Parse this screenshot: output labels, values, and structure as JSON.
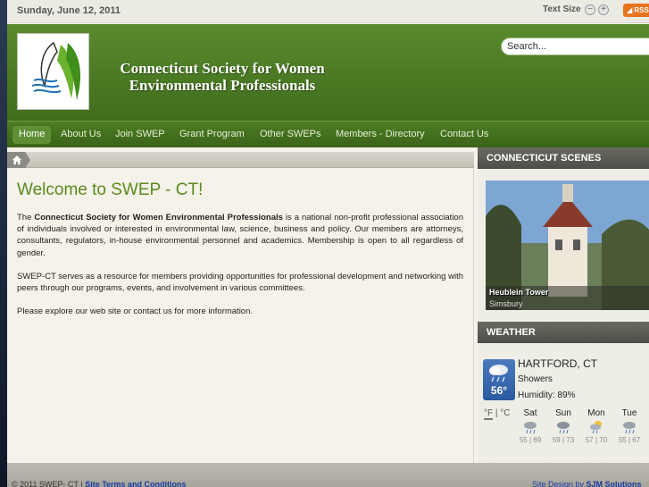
{
  "topbar": {
    "date": "Sunday, June 12, 2011",
    "text_size_label": "Text Size",
    "decrease_glyph": "−",
    "increase_glyph": "+",
    "rss_label": "RSS"
  },
  "header": {
    "title_line1": "Connecticut Society for Women",
    "title_line2": "Environmental Professionals",
    "search_placeholder": "Search..."
  },
  "nav": {
    "items": [
      {
        "label": "Home"
      },
      {
        "label": "About Us"
      },
      {
        "label": "Join SWEP"
      },
      {
        "label": "Grant Program"
      },
      {
        "label": "Other SWEPs"
      },
      {
        "label": "Members - Directory"
      },
      {
        "label": "Contact Us"
      }
    ],
    "active_index": 0
  },
  "content": {
    "heading": "Welcome to SWEP - CT!",
    "para1_prefix": "The",
    "para1_bold": "Connecticut Society for Women Environmental Professionals",
    "para1_rest": "is a national non-profit professional association of individuals involved or interested in environmental law, science, business and policy.  Our members are attorneys, consultants, regulators, in-house environmental personnel and academics.  Membership is open to all regardless of gender.",
    "para2": "SWEP-CT serves as a resource for members providing opportunities for professional development and networking with peers through our programs, events, and involvement in various committees.",
    "para3": "Please explore our web site or contact us for more information."
  },
  "sidebar": {
    "scenes_title": "CONNECTICUT SCENES",
    "scene_caption": "Heublein Tower",
    "scene_location": "Simsbury",
    "weather_title": "WEATHER",
    "current_temp": "56°",
    "city": "HARTFORD, CT",
    "condition": "Showers",
    "humidity": "Humidity: 89%",
    "unit_f": "°F",
    "unit_sep": " | ",
    "unit_c": "°C",
    "forecast": [
      {
        "day": "Sat",
        "temps": "55 | 69",
        "icon": "rain-cloud-icon"
      },
      {
        "day": "Sun",
        "temps": "59 | 73",
        "icon": "rain-cloud-icon"
      },
      {
        "day": "Mon",
        "temps": "57 | 70",
        "icon": "sun-rain-icon"
      },
      {
        "day": "Tue",
        "temps": "55 | 67",
        "icon": "rain-cloud-icon"
      }
    ]
  },
  "footer": {
    "copyright": "© 2011 SWEP- CT |",
    "terms_link": "Site Terms and Conditions",
    "design_prefix": "Site Design by",
    "design_link": "SJM Solutions"
  },
  "colors": {
    "brand_green": "#4d7c23",
    "accent_green": "#5a8a1e",
    "weather_blue": "#2a5aa0",
    "rss_orange": "#e8741d"
  }
}
